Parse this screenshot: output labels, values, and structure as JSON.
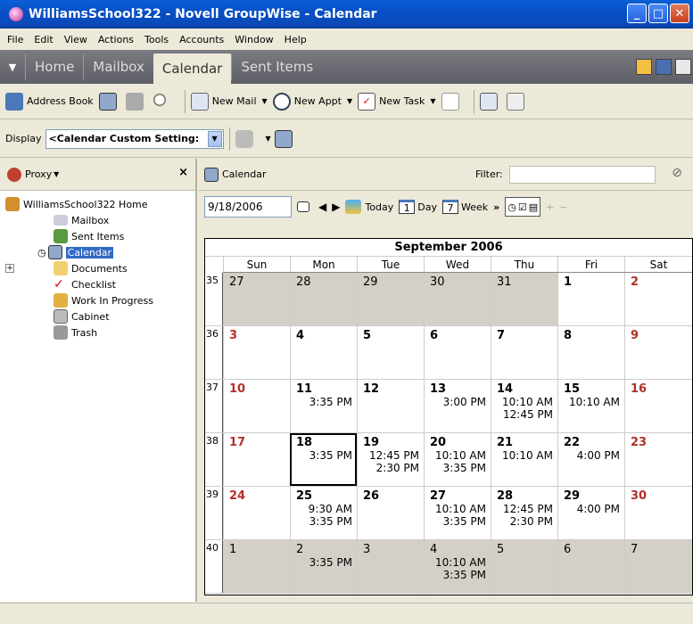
{
  "window": {
    "title": "WilliamsSchool322 - Novell GroupWise - Calendar"
  },
  "menu": [
    "File",
    "Edit",
    "View",
    "Actions",
    "Tools",
    "Accounts",
    "Window",
    "Help"
  ],
  "nav_tabs": [
    {
      "label": "Home",
      "active": false
    },
    {
      "label": "Mailbox",
      "active": false
    },
    {
      "label": "Calendar",
      "active": true
    },
    {
      "label": "Sent Items",
      "active": false
    }
  ],
  "toolbar": {
    "address_book": "Address Book",
    "new_mail": "New Mail",
    "new_appt": "New Appt",
    "new_task": "New Task"
  },
  "display": {
    "label": "Display",
    "value": "<Calendar Custom Setting:"
  },
  "left_panel": {
    "proxy": "Proxy",
    "tree": [
      {
        "label": "WilliamsSchool322 Home",
        "icon": "home-icon"
      },
      {
        "label": "Mailbox",
        "icon": "mailbox-icon"
      },
      {
        "label": "Sent Items",
        "icon": "sent-items-icon"
      },
      {
        "label": "Calendar",
        "icon": "calendar-icon",
        "selected": true
      },
      {
        "label": "Documents",
        "icon": "documents-icon"
      },
      {
        "label": "Checklist",
        "icon": "checklist-icon"
      },
      {
        "label": "Work In Progress",
        "icon": "work-in-progress-icon"
      },
      {
        "label": "Cabinet",
        "icon": "cabinet-icon"
      },
      {
        "label": "Trash",
        "icon": "trash-icon"
      }
    ]
  },
  "right_panel": {
    "header": "Calendar",
    "filter_label": "Filter:",
    "date": "9/18/2006",
    "today": "Today",
    "day_num": "1",
    "day": "Day",
    "week_num": "7",
    "week": "Week"
  },
  "calendar": {
    "month": "September 2006",
    "days": [
      "Sun",
      "Mon",
      "Tue",
      "Wed",
      "Thu",
      "Fri",
      "Sat"
    ],
    "weeks": [
      {
        "num": "35",
        "cells": [
          {
            "d": "27",
            "gray": true,
            "ev": []
          },
          {
            "d": "28",
            "gray": true,
            "ev": []
          },
          {
            "d": "29",
            "gray": true,
            "ev": []
          },
          {
            "d": "30",
            "gray": true,
            "ev": []
          },
          {
            "d": "31",
            "gray": true,
            "ev": []
          },
          {
            "d": "1",
            "ev": []
          },
          {
            "d": "2",
            "red": true,
            "ev": []
          }
        ]
      },
      {
        "num": "36",
        "cells": [
          {
            "d": "3",
            "red": true,
            "ev": []
          },
          {
            "d": "4",
            "ev": []
          },
          {
            "d": "5",
            "ev": []
          },
          {
            "d": "6",
            "ev": []
          },
          {
            "d": "7",
            "ev": []
          },
          {
            "d": "8",
            "ev": []
          },
          {
            "d": "9",
            "red": true,
            "ev": []
          }
        ]
      },
      {
        "num": "37",
        "cells": [
          {
            "d": "10",
            "red": true,
            "ev": []
          },
          {
            "d": "11",
            "ev": [
              "3:35 PM"
            ]
          },
          {
            "d": "12",
            "ev": []
          },
          {
            "d": "13",
            "ev": [
              "3:00 PM"
            ]
          },
          {
            "d": "14",
            "ev": [
              "10:10 AM",
              "12:45 PM"
            ]
          },
          {
            "d": "15",
            "ev": [
              "10:10 AM"
            ]
          },
          {
            "d": "16",
            "red": true,
            "ev": []
          }
        ]
      },
      {
        "num": "38",
        "cells": [
          {
            "d": "17",
            "red": true,
            "ev": []
          },
          {
            "d": "18",
            "today": true,
            "ev": [
              "3:35 PM"
            ]
          },
          {
            "d": "19",
            "ev": [
              "12:45 PM",
              "2:30 PM"
            ]
          },
          {
            "d": "20",
            "ev": [
              "10:10 AM",
              "3:35 PM"
            ]
          },
          {
            "d": "21",
            "ev": [
              "10:10 AM"
            ]
          },
          {
            "d": "22",
            "ev": [
              "4:00 PM"
            ]
          },
          {
            "d": "23",
            "red": true,
            "ev": []
          }
        ]
      },
      {
        "num": "39",
        "cells": [
          {
            "d": "24",
            "red": true,
            "ev": []
          },
          {
            "d": "25",
            "ev": [
              "9:30 AM",
              "3:35 PM"
            ]
          },
          {
            "d": "26",
            "ev": []
          },
          {
            "d": "27",
            "ev": [
              "10:10 AM",
              "3:35 PM"
            ]
          },
          {
            "d": "28",
            "ev": [
              "12:45 PM",
              "2:30 PM"
            ]
          },
          {
            "d": "29",
            "ev": [
              "4:00 PM"
            ]
          },
          {
            "d": "30",
            "red": true,
            "ev": []
          }
        ]
      },
      {
        "num": "40",
        "cells": [
          {
            "d": "1",
            "gray": true,
            "ev": []
          },
          {
            "d": "2",
            "gray": true,
            "ev": [
              "3:35 PM"
            ]
          },
          {
            "d": "3",
            "gray": true,
            "ev": []
          },
          {
            "d": "4",
            "gray": true,
            "ev": [
              "10:10 AM",
              "3:35 PM"
            ]
          },
          {
            "d": "5",
            "gray": true,
            "ev": []
          },
          {
            "d": "6",
            "gray": true,
            "ev": []
          },
          {
            "d": "7",
            "gray": true,
            "ev": []
          }
        ]
      }
    ]
  },
  "colors": {
    "titlebar": "#0a5fd6",
    "weekend": "#b2302a",
    "outside_month": "#d4d0c8"
  }
}
